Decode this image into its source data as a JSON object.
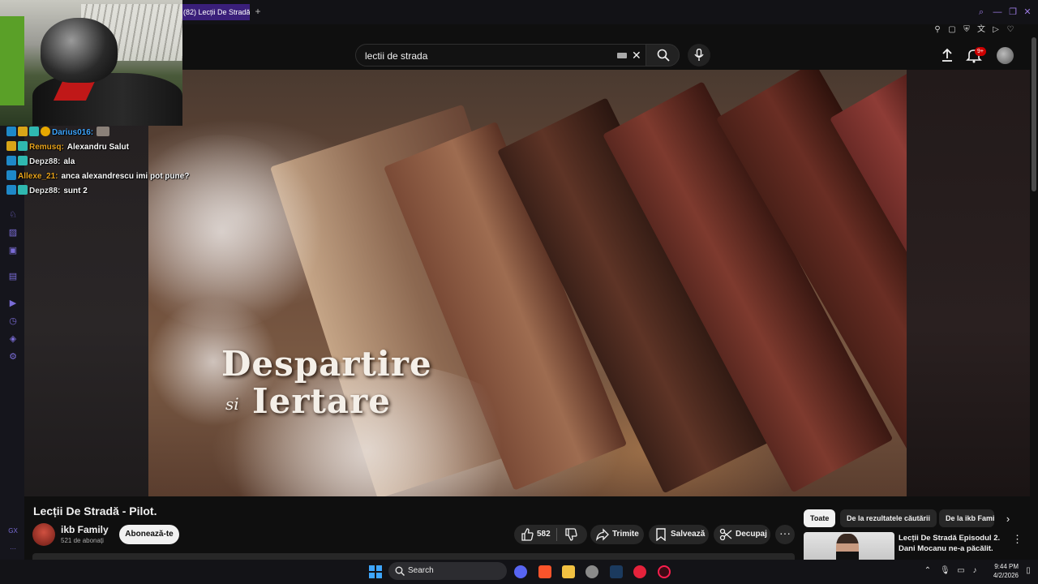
{
  "browser": {
    "tab_title": "(82) Lecții De Stradă",
    "tab_add": "+"
  },
  "sidebar": {
    "bottom_label": "GX",
    "more_label": "···"
  },
  "header": {
    "search_value": "lectii de strada",
    "notification_count": "9+"
  },
  "video": {
    "overlay_title_line1": "Despartire",
    "overlay_si": "si",
    "overlay_title_line2": "Iertare"
  },
  "chat": [
    {
      "user": "Darius016:",
      "user_color": "#3ea6ff",
      "message": "",
      "badges": [
        "sword",
        "crown",
        "grid",
        "gold"
      ],
      "emote": true
    },
    {
      "user": "Remusq:",
      "user_color": "#e8a31c",
      "message": "Alexandru Salut",
      "badges": [
        "crown",
        "grid"
      ],
      "emote": false
    },
    {
      "user": "Depz88:",
      "user_color": "#e8e8e8",
      "message": "ala",
      "badges": [
        "sword",
        "grid"
      ],
      "emote": false
    },
    {
      "user": "Allexe_21:",
      "user_color": "#e8a31c",
      "message": "anca alexandrescu imi pot pune?",
      "badges": [
        "sword"
      ],
      "emote": false
    },
    {
      "user": "Depz88:",
      "user_color": "#e8e8e8",
      "message": "sunt 2",
      "badges": [
        "sword",
        "grid"
      ],
      "emote": false
    }
  ],
  "watch": {
    "title": "Lecții De Stradă - Pilot.",
    "channel_name": "ikb Family",
    "subscribers": "521 de abonați",
    "subscribe_label": "Abonează-te",
    "like_count": "582",
    "share_label": "Trimite",
    "save_label": "Salvează",
    "clip_label": "Decupaj",
    "more_label": "···"
  },
  "chips": {
    "all": "Toate",
    "from_search": "De la rezultatele căutării",
    "from_channel": "De la ikb Family"
  },
  "recommendation": {
    "title": "Lecții De Stradă Episodul 2. Dani Mocanu ne-a păcălit."
  },
  "taskbar": {
    "search_label": "Search",
    "time": "9:44 PM",
    "date": "4/2/2026"
  },
  "colors": {
    "accent": "#7a6cd6",
    "tab_active": "#3a1f7a",
    "yt_bg": "#0f0f0f",
    "pill_bg": "#272727"
  }
}
